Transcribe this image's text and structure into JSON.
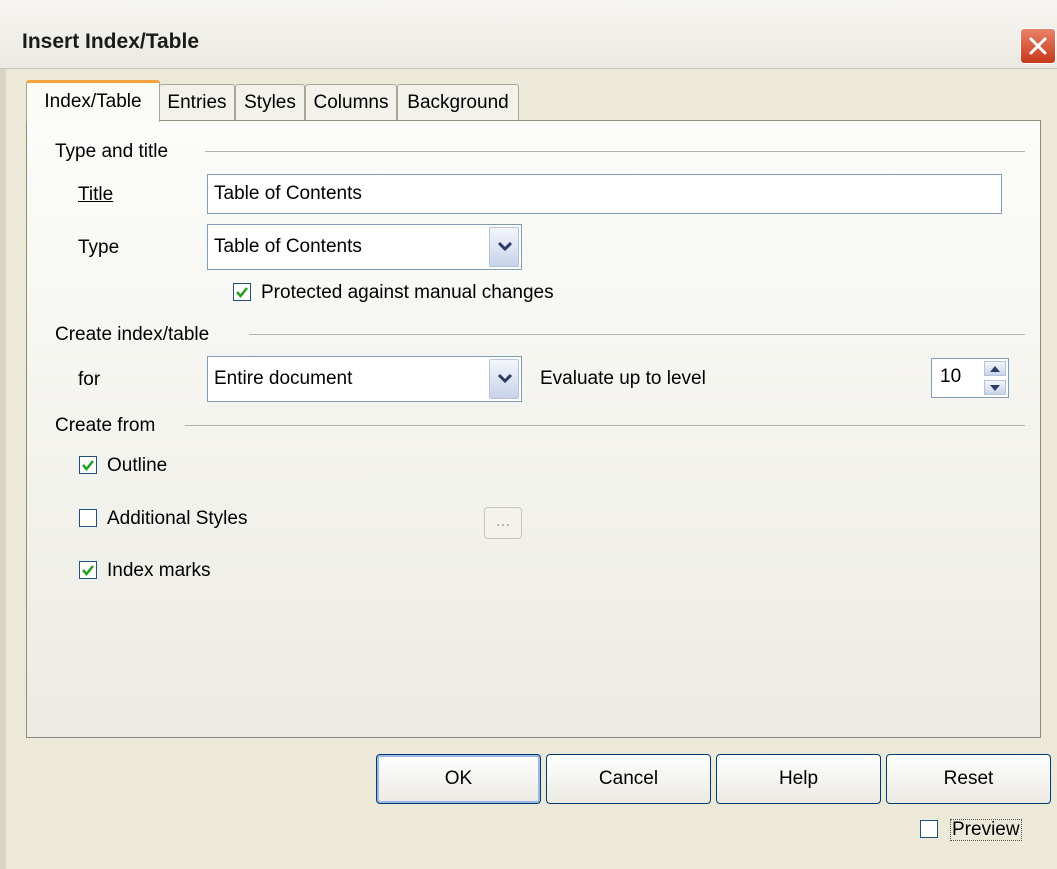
{
  "window": {
    "title": "Insert Index/Table"
  },
  "tabs": [
    "Index/Table",
    "Entries",
    "Styles",
    "Columns",
    "Background"
  ],
  "type_and_title": {
    "heading": "Type and title",
    "title_label": "Title",
    "title_value": "Table of Contents",
    "type_label": "Type",
    "type_value": "Table of Contents",
    "protected_label": "Protected against manual changes",
    "protected_checked": true
  },
  "create_index": {
    "heading": "Create index/table",
    "for_label": "for",
    "for_value": "Entire document",
    "evaluate_label": "Evaluate up to level",
    "level_value": "10"
  },
  "create_from": {
    "heading": "Create from",
    "outline_label": "Outline",
    "outline_checked": true,
    "additional_styles_label": "Additional Styles",
    "additional_styles_checked": false,
    "ellipsis_label": "...",
    "index_marks_label": "Index marks",
    "index_marks_checked": true
  },
  "buttons": {
    "ok": "OK",
    "cancel": "Cancel",
    "help": "Help",
    "reset": "Reset"
  },
  "preview": {
    "label": "Preview",
    "checked": false
  },
  "colors": {
    "dialog_bg": "#ece9d8",
    "active_tab_accent": "#f6a23c",
    "check_green": "#21a121",
    "close_red": "#c8391a"
  }
}
